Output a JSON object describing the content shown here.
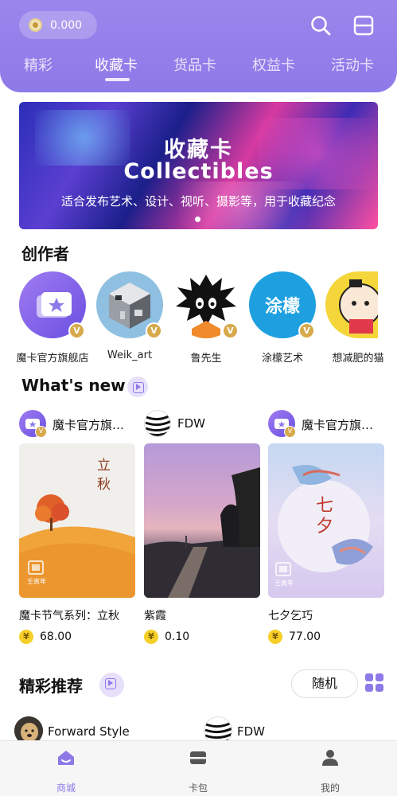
{
  "header": {
    "balance": "0.000",
    "tabs": [
      {
        "label": "精彩"
      },
      {
        "label": "收藏卡"
      },
      {
        "label": "货品卡"
      },
      {
        "label": "权益卡"
      },
      {
        "label": "活动卡"
      }
    ],
    "active_tab": "收藏卡"
  },
  "banner": {
    "title": "收藏卡",
    "subtitle": "Collectibles",
    "description": "适合发布艺术、设计、视听、摄影等，用于收藏纪念"
  },
  "creators": {
    "title": "创作者",
    "items": [
      {
        "name": "魔卡官方旗舰店"
      },
      {
        "name": "Weik_art"
      },
      {
        "name": "鲁先生"
      },
      {
        "name": "涂檬艺术"
      },
      {
        "name": "想减肥的猫"
      }
    ],
    "tumeng_logo_text": "涂檬"
  },
  "whats_new": {
    "title": "What's new",
    "cards": [
      {
        "owner": "魔卡官方旗舰店",
        "title": "魔卡节气系列：立秋",
        "price": "68.00",
        "art_text": "立秋",
        "art_stamp": "壬寅年"
      },
      {
        "owner": "FDW",
        "title": "紫霞",
        "price": "0.10"
      },
      {
        "owner": "魔卡官方旗舰店",
        "title": "七夕乞巧",
        "price": "77.00",
        "art_text": "七夕",
        "art_stamp": "壬寅年"
      }
    ],
    "currency_symbol": "¥"
  },
  "recommended": {
    "title": "精彩推荐",
    "random_label": "随机",
    "users": [
      {
        "name": "Forward Style"
      },
      {
        "name": "FDW"
      }
    ]
  },
  "bottom_nav": {
    "items": [
      {
        "label": "商城"
      },
      {
        "label": "卡包"
      },
      {
        "label": "我的"
      }
    ]
  },
  "colors": {
    "accent": "#8e79e8",
    "badge_gold": "#d6a94b",
    "price_yellow": "#f6cf28"
  }
}
